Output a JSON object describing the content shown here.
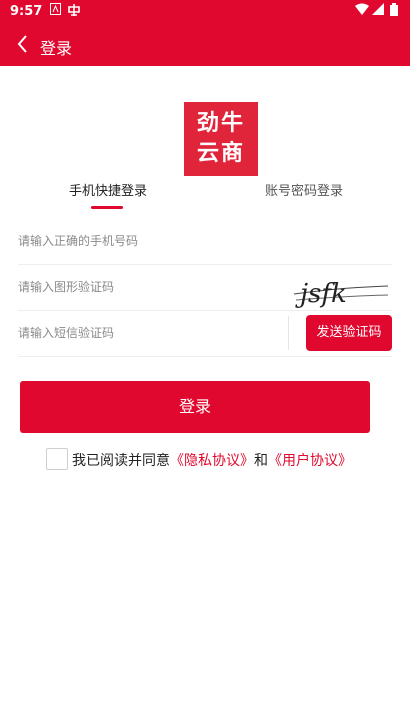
{
  "status_bar": {
    "time": "9:57"
  },
  "app_bar": {
    "title": "登录"
  },
  "logo": {
    "line1": "劲牛",
    "line2": "云商"
  },
  "tabs": [
    {
      "label": "手机快捷登录",
      "active": true
    },
    {
      "label": "账号密码登录",
      "active": false
    }
  ],
  "form": {
    "phone_placeholder": "请输入正确的手机号码",
    "captcha_placeholder": "请输入图形验证码",
    "captcha_text": "jsfk",
    "sms_placeholder": "请输入短信验证码",
    "send_code_label": "发送验证码",
    "login_label": "登录"
  },
  "agreement": {
    "prefix": "我已阅读并同意",
    "privacy": "《隐私协议》",
    "and": "和",
    "user": "《用户协议》"
  },
  "colors": {
    "primary": "#e0082e"
  }
}
